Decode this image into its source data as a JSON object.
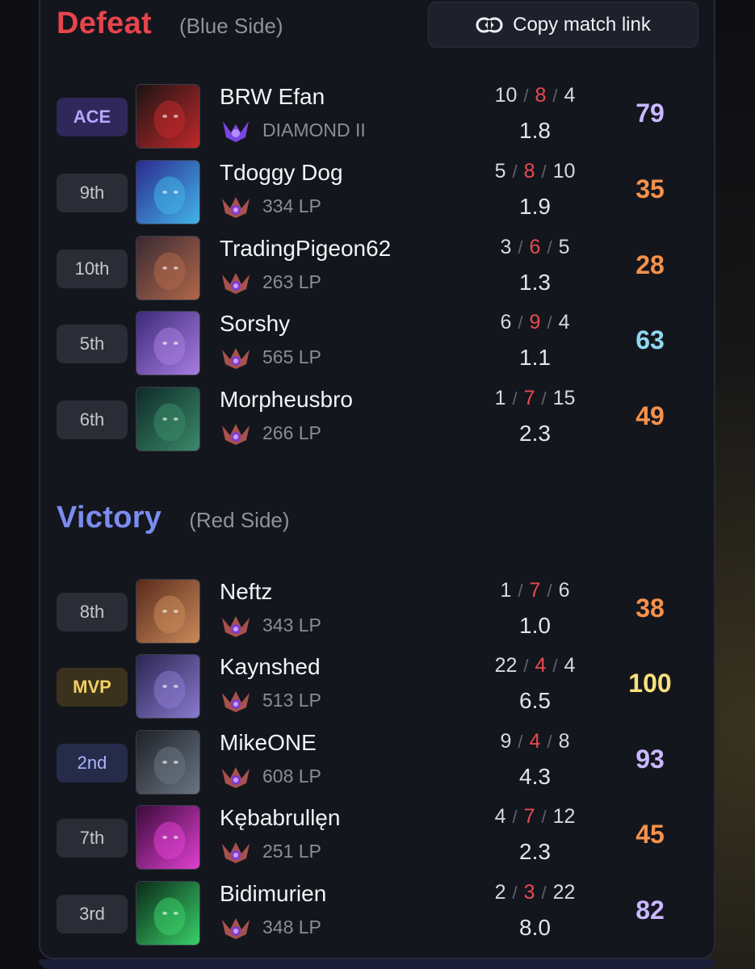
{
  "teams": [
    {
      "result": "Defeat",
      "side": "(Blue Side)",
      "result_color": "#e8444c",
      "players": [
        {
          "badge": "ACE",
          "badge_kind": "ace",
          "name": "BRW Efan",
          "rank_icon": "diamond-emblem-icon",
          "rank": "DIAMOND II",
          "kills": "10",
          "deaths": "8",
          "assists": "4",
          "kda_ratio": "1.8",
          "score": "79",
          "score_color": "#c9b8ff",
          "champ_colors": [
            "#1a1414",
            "#c0282a"
          ]
        },
        {
          "badge": "9th",
          "badge_kind": "normal",
          "name": "Tdoggy Dog",
          "rank_icon": "master-emblem-icon",
          "rank": "334 LP",
          "kills": "5",
          "deaths": "8",
          "assists": "10",
          "kda_ratio": "1.9",
          "score": "35",
          "score_color": "#f5914a",
          "champ_colors": [
            "#2b2a8f",
            "#42b4e8"
          ]
        },
        {
          "badge": "10th",
          "badge_kind": "normal",
          "name": "TradingPigeon62",
          "rank_icon": "master-emblem-icon",
          "rank": "263 LP",
          "kills": "3",
          "deaths": "6",
          "assists": "5",
          "kda_ratio": "1.3",
          "score": "28",
          "score_color": "#f5914a",
          "champ_colors": [
            "#3a2a33",
            "#b0674a"
          ]
        },
        {
          "badge": "5th",
          "badge_kind": "normal",
          "name": "Sorshy",
          "rank_icon": "master-emblem-icon",
          "rank": "565 LP",
          "kills": "6",
          "deaths": "9",
          "assists": "4",
          "kda_ratio": "1.1",
          "score": "63",
          "score_color": "#8fd8f0",
          "champ_colors": [
            "#3d2a7a",
            "#a77de0"
          ]
        },
        {
          "badge": "6th",
          "badge_kind": "normal",
          "name": "Morpheusbro",
          "rank_icon": "master-emblem-icon",
          "rank": "266 LP",
          "kills": "1",
          "deaths": "7",
          "assists": "15",
          "kda_ratio": "2.3",
          "score": "49",
          "score_color": "#f5914a",
          "champ_colors": [
            "#0f2a28",
            "#3a8a6a"
          ]
        }
      ]
    },
    {
      "result": "Victory",
      "side": "(Red Side)",
      "result_color": "#7b8cf0",
      "players": [
        {
          "badge": "8th",
          "badge_kind": "normal",
          "name": "Neftz",
          "rank_icon": "master-emblem-icon",
          "rank": "343 LP",
          "kills": "1",
          "deaths": "7",
          "assists": "6",
          "kda_ratio": "1.0",
          "score": "38",
          "score_color": "#f5914a",
          "champ_colors": [
            "#5a2a1c",
            "#c98a5a"
          ]
        },
        {
          "badge": "MVP",
          "badge_kind": "mvp",
          "name": "Kaynshed",
          "rank_icon": "master-emblem-icon",
          "rank": "513 LP",
          "kills": "22",
          "deaths": "4",
          "assists": "4",
          "kda_ratio": "6.5",
          "score": "100",
          "score_color": "#f7e17a",
          "champ_colors": [
            "#2a2550",
            "#8a7ad0"
          ]
        },
        {
          "badge": "2nd",
          "badge_kind": "second",
          "name": "MikeONE",
          "rank_icon": "master-emblem-icon",
          "rank": "608 LP",
          "kills": "9",
          "deaths": "4",
          "assists": "8",
          "kda_ratio": "4.3",
          "score": "93",
          "score_color": "#c9b8ff",
          "champ_colors": [
            "#1e2228",
            "#6a7482"
          ]
        },
        {
          "badge": "7th",
          "badge_kind": "normal",
          "name": "Kębabrullęn",
          "rank_icon": "master-emblem-icon",
          "rank": "251 LP",
          "kills": "4",
          "deaths": "7",
          "assists": "12",
          "kda_ratio": "2.3",
          "score": "45",
          "score_color": "#f5914a",
          "champ_colors": [
            "#3a0a3a",
            "#e040d0"
          ]
        },
        {
          "badge": "3rd",
          "badge_kind": "normal",
          "name": "Bidimurien",
          "rank_icon": "master-emblem-icon",
          "rank": "348 LP",
          "kills": "2",
          "deaths": "3",
          "assists": "22",
          "kda_ratio": "8.0",
          "score": "82",
          "score_color": "#c9b8ff",
          "champ_colors": [
            "#0a2a18",
            "#3ad06a"
          ]
        }
      ]
    }
  ],
  "copy_link": {
    "label": "Copy match link",
    "icon": "link-icon"
  }
}
